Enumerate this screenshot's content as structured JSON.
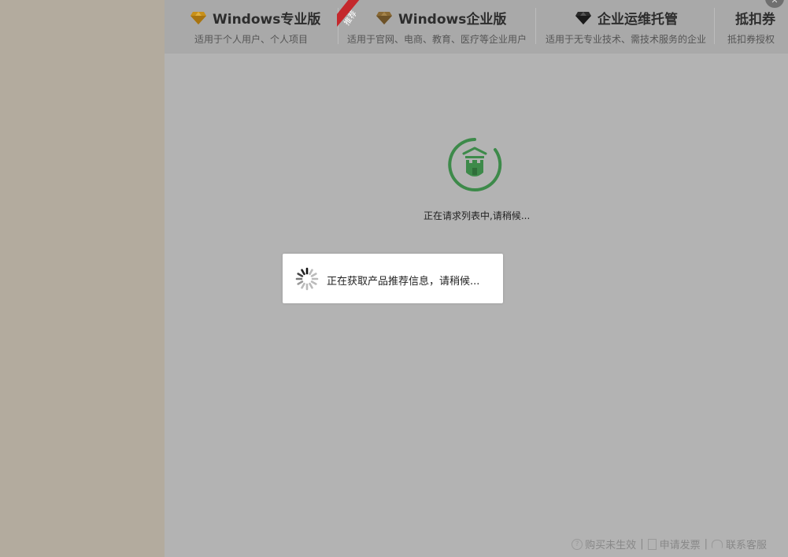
{
  "tabs": [
    {
      "title": "Windows专业版",
      "subtitle": "适用于个人用户、个人项目",
      "icon": "gold-diamond-icon",
      "color": "#c8901a"
    },
    {
      "title": "Windows企业版",
      "subtitle": "适用于官网、电商、教育、医疗等企业用户",
      "icon": "bronze-diamond-icon",
      "color": "#8a6a36",
      "badge": "推荐"
    },
    {
      "title": "企业运维托管",
      "subtitle": "适用于无专业技术、需技术服务的企业",
      "icon": "black-diamond-icon",
      "color": "#2b2b2b"
    },
    {
      "title": "抵扣券",
      "subtitle": "抵扣券授权"
    }
  ],
  "loading": {
    "list_status": "正在请求列表中,请稍候...",
    "icon": "castle-shield-icon",
    "ring_color": "#3d8a4a"
  },
  "dialog": {
    "message": "正在获取产品推荐信息，请稍候..."
  },
  "footer": {
    "purchase_label": "购买未生效",
    "invoice_label": "申请发票",
    "support_label": "联系客服",
    "separator": "|"
  },
  "colors": {
    "ribbon": "#c4282c",
    "overlay": "#b3b3b3"
  }
}
